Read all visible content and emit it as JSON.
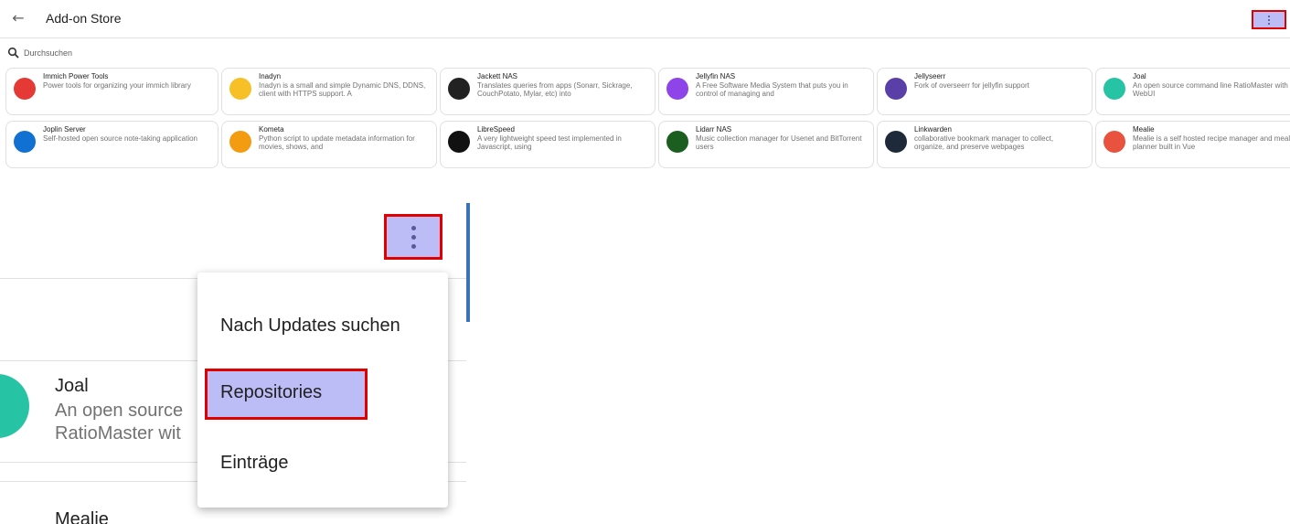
{
  "header": {
    "title": "Add-on Store"
  },
  "search": {
    "placeholder": "Durchsuchen"
  },
  "addons": [
    {
      "name": "Immich Power Tools",
      "desc": "Power tools for organizing your immich library",
      "icon": "immich-icon",
      "color": "#e53935"
    },
    {
      "name": "Inadyn",
      "desc": "Inadyn is a small and simple Dynamic DNS, DDNS, client with HTTPS support. A",
      "icon": "inadyn-icon",
      "color": "#f6c026"
    },
    {
      "name": "Jackett NAS",
      "desc": "Translates queries from apps (Sonarr, Sickrage, CouchPotato, Mylar, etc) into",
      "icon": "jackett-icon",
      "color": "#222222"
    },
    {
      "name": "Jellyfin NAS",
      "desc": "A Free Software Media System that puts you in control of managing and",
      "icon": "jellyfin-icon",
      "color": "#8e44e8"
    },
    {
      "name": "Jellyseerr",
      "desc": "Fork of overseerr for jellyfin support",
      "icon": "jellyseerr-icon",
      "color": "#5b3fa8"
    },
    {
      "name": "Joal",
      "desc": "An open source command line RatioMaster with WebUI",
      "icon": "joal-icon",
      "color": "#27c3a5"
    },
    {
      "name": "Joplin Server",
      "desc": "Self-hosted open source note-taking application",
      "icon": "joplin-icon",
      "color": "#1071d3"
    },
    {
      "name": "Kometa",
      "desc": "Python script to update metadata information for movies, shows, and",
      "icon": "kometa-icon",
      "color": "#f39c12"
    },
    {
      "name": "LibreSpeed",
      "desc": "A very lightweight speed test implemented in Javascript, using",
      "icon": "librespeed-icon",
      "color": "#111111"
    },
    {
      "name": "Lidarr NAS",
      "desc": "Music collection manager for Usenet and BitTorrent users",
      "icon": "lidarr-icon",
      "color": "#1b5e20"
    },
    {
      "name": "Linkwarden",
      "desc": "collaborative bookmark manager to collect, organize, and preserve webpages",
      "icon": "linkwarden-icon",
      "color": "#1e2a3a"
    },
    {
      "name": "Mealie",
      "desc": "Mealie is a self hosted recipe manager and meal planner built in Vue",
      "icon": "mealie-icon",
      "color": "#e8523f"
    }
  ],
  "zoom": {
    "card_title": "Joal",
    "card_desc": "An open source RatioMaster wit",
    "card2_title": "Mealie"
  },
  "menu": {
    "check_updates": "Nach Updates suchen",
    "repositories": "Repositories",
    "entries": "Einträge"
  }
}
